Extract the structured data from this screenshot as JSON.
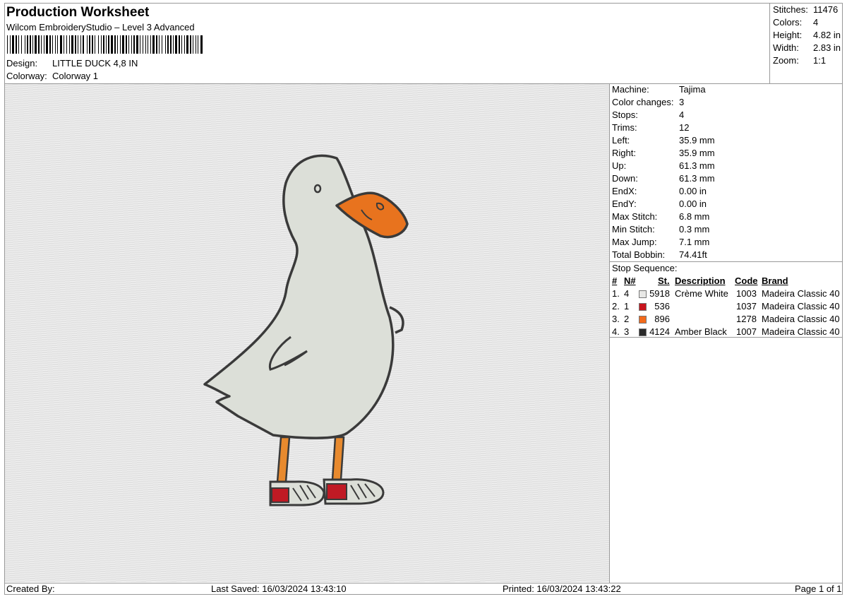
{
  "header": {
    "title": "Production Worksheet",
    "subtitle": "Wilcom EmbroideryStudio – Level 3 Advanced",
    "design_label": "Design:",
    "design_value": "LITTLE DUCK 4,8 IN",
    "colorway_label": "Colorway:",
    "colorway_value": "Colorway 1"
  },
  "summary": [
    {
      "label": "Stitches:",
      "value": "11476"
    },
    {
      "label": "Colors:",
      "value": "4"
    },
    {
      "label": "Height:",
      "value": "4.82 in"
    },
    {
      "label": "Width:",
      "value": "2.83 in"
    },
    {
      "label": "Zoom:",
      "value": "1:1"
    }
  ],
  "machine_info": [
    {
      "label": "Machine:",
      "value": "Tajima"
    },
    {
      "label": "Color changes:",
      "value": "3"
    },
    {
      "label": "Stops:",
      "value": "4"
    },
    {
      "label": "Trims:",
      "value": "12"
    },
    {
      "label": "Left:",
      "value": "35.9 mm"
    },
    {
      "label": "Right:",
      "value": "35.9 mm"
    },
    {
      "label": "Up:",
      "value": "61.3 mm"
    },
    {
      "label": "Down:",
      "value": "61.3 mm"
    },
    {
      "label": "EndX:",
      "value": "0.00 in"
    },
    {
      "label": "EndY:",
      "value": "0.00 in"
    },
    {
      "label": "Max Stitch:",
      "value": "6.8 mm"
    },
    {
      "label": "Min Stitch:",
      "value": "0.3 mm"
    },
    {
      "label": "Max Jump:",
      "value": "7.1 mm"
    },
    {
      "label": "Total Bobbin:",
      "value": "74.41ft"
    }
  ],
  "stop_sequence": {
    "title": "Stop Sequence:",
    "headers": {
      "num": "#",
      "n": "N#",
      "st": "St.",
      "description": "Description",
      "code": "Code",
      "brand": "Brand"
    },
    "rows": [
      {
        "num": "1.",
        "n": "4",
        "color": "#e8e8e6",
        "st": "5918",
        "description": "Crème White",
        "code": "1003",
        "brand": "Madeira Classic 40"
      },
      {
        "num": "2.",
        "n": "1",
        "color": "#c8141e",
        "st": "536",
        "description": "",
        "code": "1037",
        "brand": "Madeira Classic 40"
      },
      {
        "num": "3.",
        "n": "2",
        "color": "#f26a1b",
        "st": "896",
        "description": "",
        "code": "1278",
        "brand": "Madeira Classic 40"
      },
      {
        "num": "4.",
        "n": "3",
        "color": "#2a2a2a",
        "st": "4124",
        "description": "Amber Black",
        "code": "1007",
        "brand": "Madeira Classic 40"
      }
    ]
  },
  "footer": {
    "created_by": "Created By:",
    "last_saved": "Last Saved: 16/03/2024 13:43:10",
    "printed": "Printed: 16/03/2024 13:43:22",
    "page": "Page 1 of 1"
  },
  "design_colors": {
    "body": "#dcdfd8",
    "outline": "#3a3a3a",
    "beak": "#e8731e",
    "shoe_red": "#c01a24",
    "leg": "#e88a2e"
  }
}
